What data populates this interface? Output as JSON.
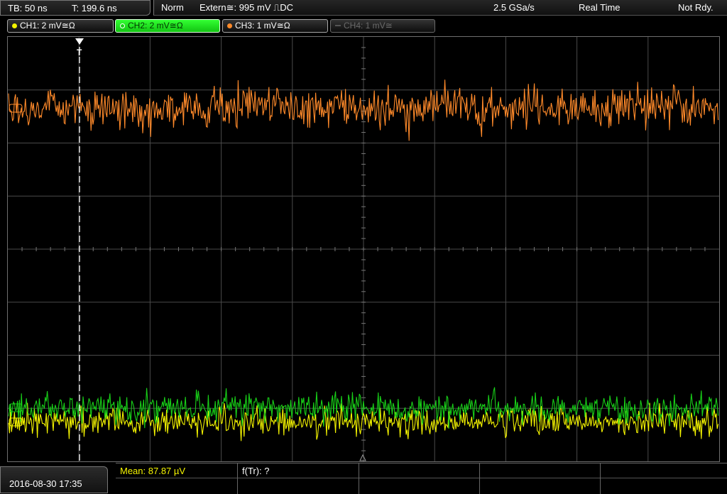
{
  "status": {
    "timebase": "TB: 50 ns",
    "trigger_time": "T: 199.6 ns",
    "trigger_mode": "Norm",
    "trigger_source": "Extern≅: 995 mV ⎍DC",
    "sample_rate": "2.5 GSa/s",
    "acq_mode": "Real Time",
    "state": "Not Rdy."
  },
  "channels": [
    {
      "label": "CH1: 2 mV≅Ω",
      "color": "#f5f500",
      "active": true
    },
    {
      "label": "CH2: 2 mV≅Ω",
      "color": "#18d018",
      "active": true,
      "selected": true
    },
    {
      "label": "CH3: 1 mV≅Ω",
      "color": "#ff8a2a",
      "active": true
    },
    {
      "label": "CH4: 1 mV≅",
      "color": "#6a6a6a",
      "active": false
    }
  ],
  "screen": {
    "trigger_marker": "T",
    "grid_color": "#4a4a4a"
  },
  "footer": {
    "datetime": "2016-08-30 17:35",
    "measurements": [
      {
        "label": "Mean: 87.87 µV",
        "color": "#f5f500"
      },
      {
        "label": "f(Tr): ?",
        "color": "#ffffff"
      }
    ]
  }
}
